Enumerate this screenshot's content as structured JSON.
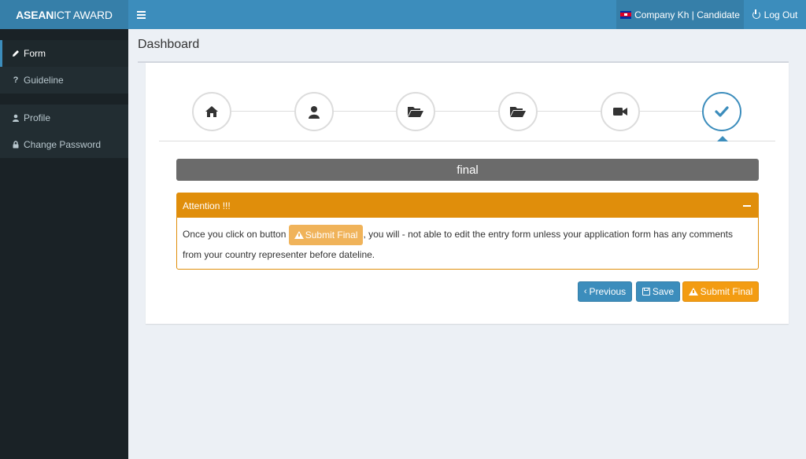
{
  "brand": {
    "logo_bold": "ASEAN",
    "logo_rest": "ICT AWARD"
  },
  "topbar": {
    "user_label": "Company Kh | Candidate",
    "logout_label": "Log Out"
  },
  "sidebar": {
    "items": [
      {
        "label": "Form",
        "icon": "pencil-icon"
      },
      {
        "label": "Guideline",
        "icon": "question-icon"
      },
      {
        "label": "Profile",
        "icon": "user-icon"
      },
      {
        "label": "Change Password",
        "icon": "lock-icon"
      }
    ]
  },
  "page": {
    "title": "Dashboard"
  },
  "wizard": {
    "steps": [
      {
        "icon": "home-icon"
      },
      {
        "icon": "user-icon"
      },
      {
        "icon": "folder-open-icon"
      },
      {
        "icon": "folder-open-icon"
      },
      {
        "icon": "video-camera-icon"
      },
      {
        "icon": "check-icon"
      }
    ],
    "active_step": 5,
    "section_title": "final"
  },
  "attention": {
    "title": "Attention !!!",
    "text_before": "Once you click on button ",
    "inline_button": "Submit Final",
    "text_after": ", you will - not able to edit the entry form unless your application form has any comments from your country representer before dateline."
  },
  "actions": {
    "previous": "Previous",
    "save": "Save",
    "submit": "Submit Final"
  },
  "colors": {
    "primary": "#3c8dbc",
    "warning": "#f39c12",
    "sidebar": "#222d32"
  }
}
